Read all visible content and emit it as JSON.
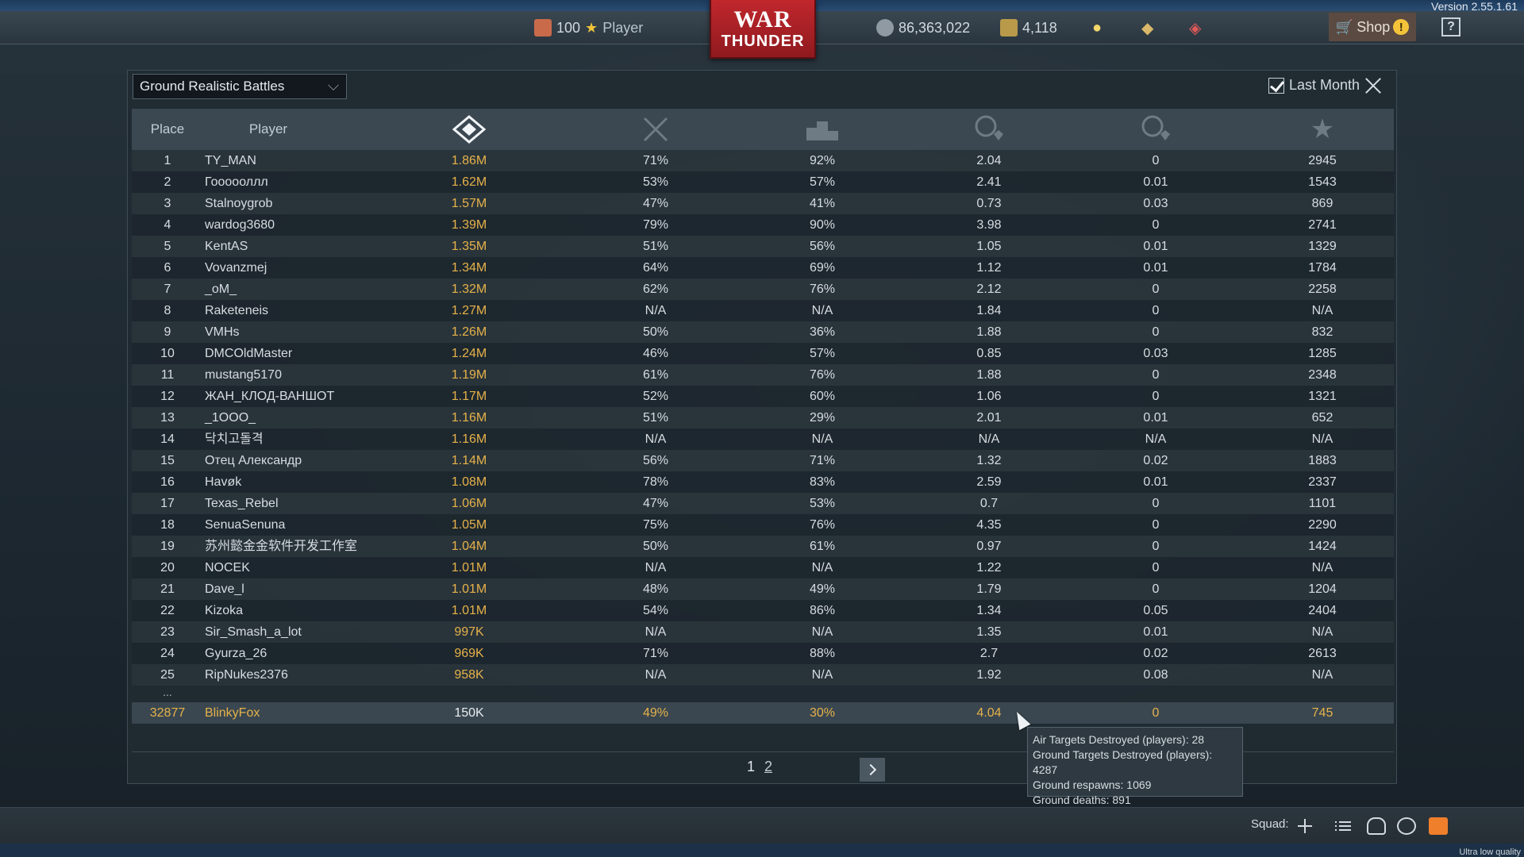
{
  "version": "Version 2.55.1.61",
  "topbar": {
    "rank": "100",
    "player_label": "Player",
    "silver_lions": "86,363,022",
    "golden_eagles": "4,118",
    "shop_label": "Shop",
    "shop_alert": "!",
    "help": "?",
    "logo_line1": "WAR",
    "logo_line2": "THUNDER"
  },
  "panel": {
    "mode": "Ground Realistic Battles",
    "last_month_label": "Last Month",
    "columns": {
      "place": "Place",
      "player": "Player"
    },
    "column_icons": [
      "efficiency-icon",
      "kills-crossed-swords-icon",
      "victories-podium-icon",
      "kills-per-death-icon",
      "air-kills-per-death-icon",
      "score-star-icon"
    ],
    "rows": [
      {
        "place": "1",
        "name": "TY_MAN",
        "rating": "1.86M",
        "s1": "71%",
        "s2": "92%",
        "s3": "2.04",
        "s4": "0",
        "s5": "2945"
      },
      {
        "place": "2",
        "name": "Гоооооллл",
        "rating": "1.62M",
        "s1": "53%",
        "s2": "57%",
        "s3": "2.41",
        "s4": "0.01",
        "s5": "1543"
      },
      {
        "place": "3",
        "name": "Stalnoygrob",
        "rating": "1.57M",
        "s1": "47%",
        "s2": "41%",
        "s3": "0.73",
        "s4": "0.03",
        "s5": "869"
      },
      {
        "place": "4",
        "name": "wardog3680",
        "rating": "1.39M",
        "s1": "79%",
        "s2": "90%",
        "s3": "3.98",
        "s4": "0",
        "s5": "2741"
      },
      {
        "place": "5",
        "name": "KentAS",
        "rating": "1.35M",
        "s1": "51%",
        "s2": "56%",
        "s3": "1.05",
        "s4": "0.01",
        "s5": "1329"
      },
      {
        "place": "6",
        "name": "Vovanzmej",
        "rating": "1.34M",
        "s1": "64%",
        "s2": "69%",
        "s3": "1.12",
        "s4": "0.01",
        "s5": "1784"
      },
      {
        "place": "7",
        "name": "_oM_",
        "rating": "1.32M",
        "s1": "62%",
        "s2": "76%",
        "s3": "2.12",
        "s4": "0",
        "s5": "2258"
      },
      {
        "place": "8",
        "name": "Raketeneis",
        "rating": "1.27M",
        "s1": "N/A",
        "s2": "N/A",
        "s3": "1.84",
        "s4": "0",
        "s5": "N/A"
      },
      {
        "place": "9",
        "name": "VMHs",
        "rating": "1.26M",
        "s1": "50%",
        "s2": "36%",
        "s3": "1.88",
        "s4": "0",
        "s5": "832"
      },
      {
        "place": "10",
        "name": "DMCOldMaster",
        "rating": "1.24M",
        "s1": "46%",
        "s2": "57%",
        "s3": "0.85",
        "s4": "0.03",
        "s5": "1285"
      },
      {
        "place": "11",
        "name": "mustang5170",
        "rating": "1.19M",
        "s1": "61%",
        "s2": "76%",
        "s3": "1.88",
        "s4": "0",
        "s5": "2348"
      },
      {
        "place": "12",
        "name": "ЖАН_КЛОД-ВАНШОТ",
        "rating": "1.17M",
        "s1": "52%",
        "s2": "60%",
        "s3": "1.06",
        "s4": "0",
        "s5": "1321"
      },
      {
        "place": "13",
        "name": "_1OOO_",
        "rating": "1.16M",
        "s1": "51%",
        "s2": "29%",
        "s3": "2.01",
        "s4": "0.01",
        "s5": "652"
      },
      {
        "place": "14",
        "name": "닥치고돌격",
        "rating": "1.16M",
        "s1": "N/A",
        "s2": "N/A",
        "s3": "N/A",
        "s4": "N/A",
        "s5": "N/A"
      },
      {
        "place": "15",
        "name": "Отец Александр",
        "rating": "1.14M",
        "s1": "56%",
        "s2": "71%",
        "s3": "1.32",
        "s4": "0.02",
        "s5": "1883"
      },
      {
        "place": "16",
        "name": "Havøk",
        "rating": "1.08M",
        "s1": "78%",
        "s2": "83%",
        "s3": "2.59",
        "s4": "0.01",
        "s5": "2337"
      },
      {
        "place": "17",
        "name": "Texas_Rebel",
        "rating": "1.06M",
        "s1": "47%",
        "s2": "53%",
        "s3": "0.7",
        "s4": "0",
        "s5": "1101"
      },
      {
        "place": "18",
        "name": "SenuaSenuna",
        "rating": "1.05M",
        "s1": "75%",
        "s2": "76%",
        "s3": "4.35",
        "s4": "0",
        "s5": "2290"
      },
      {
        "place": "19",
        "name": "苏州懿金金软件开发工作室",
        "rating": "1.04M",
        "s1": "50%",
        "s2": "61%",
        "s3": "0.97",
        "s4": "0",
        "s5": "1424"
      },
      {
        "place": "20",
        "name": "NOCEK",
        "rating": "1.01M",
        "s1": "N/A",
        "s2": "N/A",
        "s3": "1.22",
        "s4": "0",
        "s5": "N/A"
      },
      {
        "place": "21",
        "name": "Dave_l",
        "rating": "1.01M",
        "s1": "48%",
        "s2": "49%",
        "s3": "1.79",
        "s4": "0",
        "s5": "1204"
      },
      {
        "place": "22",
        "name": "Kizoka",
        "rating": "1.01M",
        "s1": "54%",
        "s2": "86%",
        "s3": "1.34",
        "s4": "0.05",
        "s5": "2404"
      },
      {
        "place": "23",
        "name": "Sir_Smash_a_lot",
        "rating": "997K",
        "s1": "N/A",
        "s2": "N/A",
        "s3": "1.35",
        "s4": "0.01",
        "s5": "N/A"
      },
      {
        "place": "24",
        "name": "Gyurza_26",
        "rating": "969K",
        "s1": "71%",
        "s2": "88%",
        "s3": "2.7",
        "s4": "0.02",
        "s5": "2613"
      },
      {
        "place": "25",
        "name": "RipNukes2376",
        "rating": "958K",
        "s1": "N/A",
        "s2": "N/A",
        "s3": "1.92",
        "s4": "0.08",
        "s5": "N/A"
      }
    ],
    "ellipsis": "...",
    "me": {
      "place": "32877",
      "name": "BlinkyFox",
      "rating": "150K",
      "s1": "49%",
      "s2": "30%",
      "s3": "4.04",
      "s4": "0",
      "s5": "745"
    },
    "pages": [
      "1",
      "2"
    ]
  },
  "tooltip": {
    "line1": "Air Targets Destroyed (players): 28",
    "line2": "Ground Targets Destroyed (players): 4287",
    "line3": "Ground respawns: 1069",
    "line4": "Ground deaths: 891"
  },
  "bottombar": {
    "squad_label": "Squad:",
    "quality": "Ultra low quality"
  },
  "colors": {
    "accent_gold": "#e6b24a",
    "logo_red": "#c0272d",
    "mail_orange": "#f07f2c"
  }
}
